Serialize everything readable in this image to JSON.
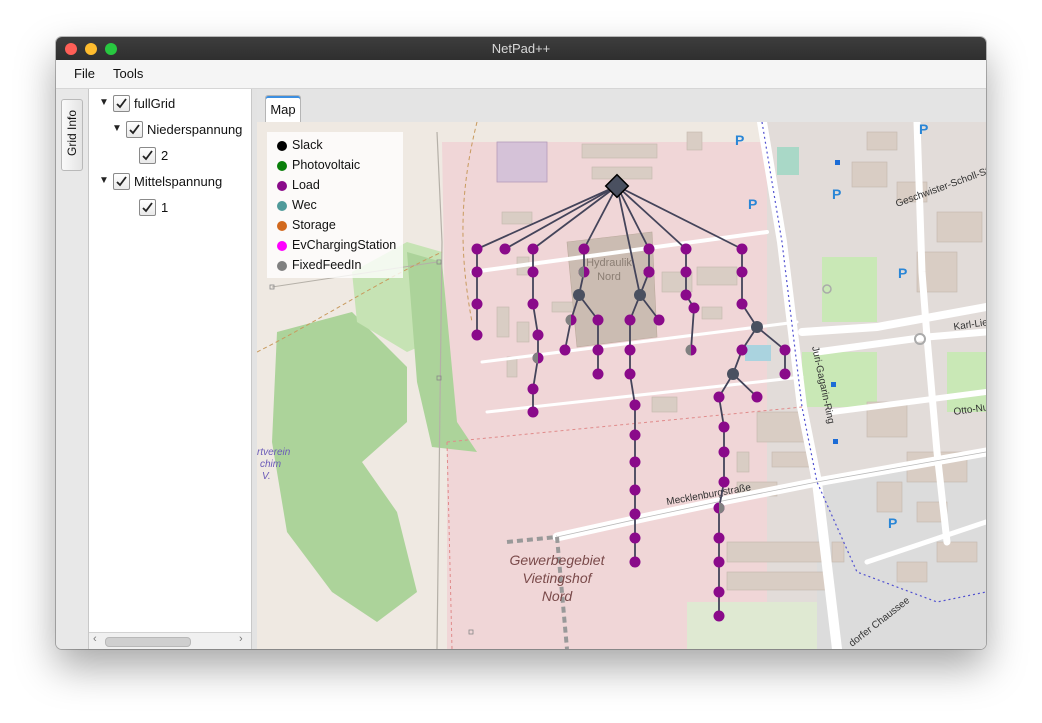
{
  "window": {
    "title": "NetPad++"
  },
  "menu": {
    "file": "File",
    "tools": "Tools"
  },
  "side_tab": {
    "label": "Grid Info"
  },
  "tree": {
    "root": "fullGrid",
    "group1": "Niederspannung",
    "group1_child": "2",
    "group2": "Mittelspannung",
    "group2_child": "1"
  },
  "tabs": {
    "map": "Map"
  },
  "legend": [
    {
      "label": "Slack",
      "color": "#000000"
    },
    {
      "label": "Photovoltaic",
      "color": "#0a7f0a"
    },
    {
      "label": "Load",
      "color": "#8a0a8a"
    },
    {
      "label": "Wec",
      "color": "#4f9a9a"
    },
    {
      "label": "Storage",
      "color": "#d2691e"
    },
    {
      "label": "EvChargingStation",
      "color": "#ff00ff"
    },
    {
      "label": "FixedFeedIn",
      "color": "#808080"
    }
  ],
  "map_labels": {
    "area_name": [
      "Gewerbegebiet",
      "Vietingshof",
      "Nord"
    ],
    "street_mecklenburg": "Mecklenburgstraße",
    "street_juri": "Juri-Gagarin-Ring",
    "street_karl": "Karl-Lie",
    "street_otto": "Otto-Nu",
    "street_geschwister": "Geschwister-Scholl-Straße",
    "street_chaussee": "dorfer Chaussee",
    "poi_hydraulik": [
      "Hydraulik",
      "Nord"
    ],
    "club": [
      "rtverein",
      "chim",
      "V."
    ],
    "parking": "P"
  }
}
